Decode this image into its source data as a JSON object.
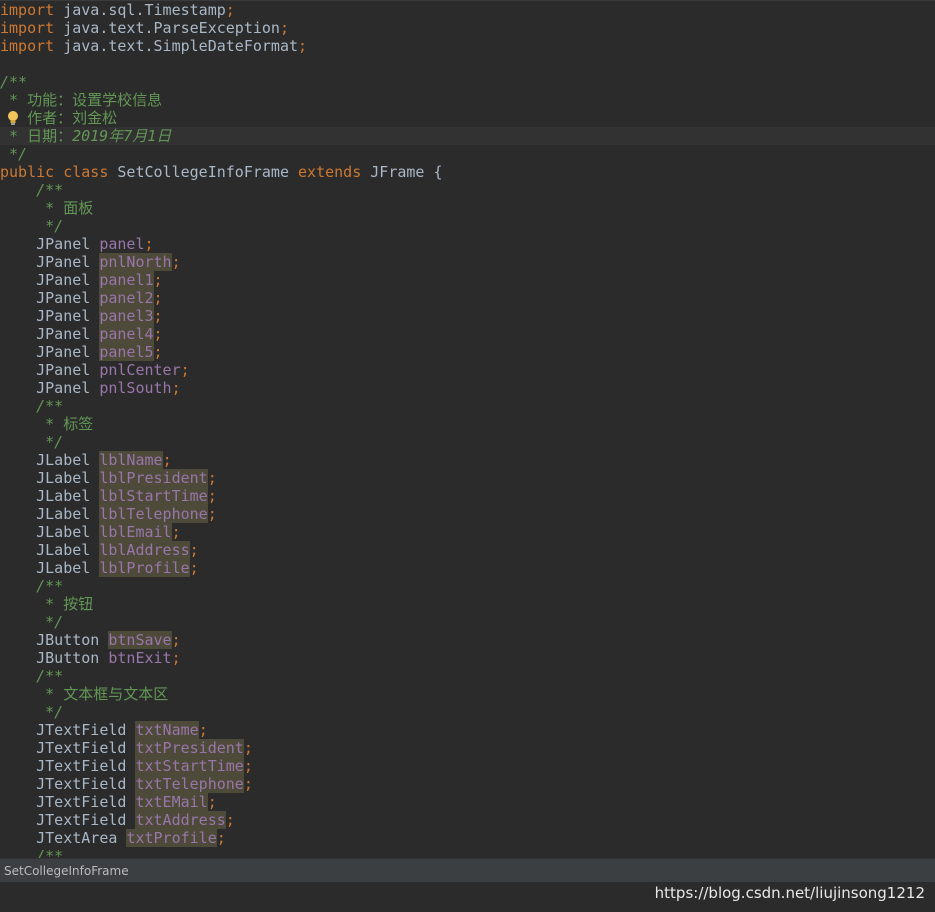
{
  "editor": {
    "lines": [
      {
        "i": 0,
        "segs": [
          {
            "t": "import",
            "c": "kw"
          },
          {
            "t": " java.sql.Timestamp"
          },
          {
            "t": ";",
            "c": "semi"
          }
        ]
      },
      {
        "i": 1,
        "segs": [
          {
            "t": "import",
            "c": "kw"
          },
          {
            "t": " java.text.ParseException"
          },
          {
            "t": ";",
            "c": "semi"
          }
        ]
      },
      {
        "i": 2,
        "segs": [
          {
            "t": "import",
            "c": "kw"
          },
          {
            "t": " java.text.SimpleDateFormat"
          },
          {
            "t": ";",
            "c": "semi"
          }
        ]
      },
      {
        "i": 4,
        "segs": [
          {
            "t": "/**",
            "c": "cm-it"
          }
        ]
      },
      {
        "i": 5,
        "segs": [
          {
            "t": " * 功能：设置学校信息",
            "c": "cm"
          }
        ]
      },
      {
        "i": 6,
        "segs": [
          {
            "t": " * 作者：刘金松",
            "c": "cm"
          }
        ],
        "bulb": true
      },
      {
        "i": 7,
        "segs": [
          {
            "t": " * 日期：",
            "c": "cm"
          },
          {
            "t": "2019年7月1日",
            "c": "cm-it"
          }
        ],
        "current": true
      },
      {
        "i": 8,
        "segs": [
          {
            "t": " */",
            "c": "cm-it"
          }
        ]
      },
      {
        "i": 9,
        "segs": [
          {
            "t": "public class ",
            "c": "kw"
          },
          {
            "t": "SetCollegeInfoFrame "
          },
          {
            "t": "extends ",
            "c": "kw"
          },
          {
            "t": "JFrame {"
          }
        ]
      },
      {
        "i": 10,
        "segs": [
          {
            "t": "    /**",
            "c": "cm-it"
          }
        ]
      },
      {
        "i": 11,
        "segs": [
          {
            "t": "     * 面板",
            "c": "cm"
          }
        ]
      },
      {
        "i": 12,
        "segs": [
          {
            "t": "     */",
            "c": "cm-it"
          }
        ]
      },
      {
        "i": 13,
        "segs": [
          {
            "t": "    JPanel "
          },
          {
            "t": "panel",
            "c": "fld"
          },
          {
            "t": ";",
            "c": "semi"
          }
        ]
      },
      {
        "i": 14,
        "segs": [
          {
            "t": "    JPanel "
          },
          {
            "t": "pnlNorth",
            "c": "fld hl"
          },
          {
            "t": ";",
            "c": "semi"
          }
        ]
      },
      {
        "i": 15,
        "segs": [
          {
            "t": "    JPanel "
          },
          {
            "t": "panel1",
            "c": "fld hl"
          },
          {
            "t": ";",
            "c": "semi"
          }
        ]
      },
      {
        "i": 16,
        "segs": [
          {
            "t": "    JPanel "
          },
          {
            "t": "panel2",
            "c": "fld hl"
          },
          {
            "t": ";",
            "c": "semi"
          }
        ]
      },
      {
        "i": 17,
        "segs": [
          {
            "t": "    JPanel "
          },
          {
            "t": "panel3",
            "c": "fld hl"
          },
          {
            "t": ";",
            "c": "semi"
          }
        ]
      },
      {
        "i": 18,
        "segs": [
          {
            "t": "    JPanel "
          },
          {
            "t": "panel4",
            "c": "fld hl"
          },
          {
            "t": ";",
            "c": "semi"
          }
        ]
      },
      {
        "i": 19,
        "segs": [
          {
            "t": "    JPanel "
          },
          {
            "t": "panel5",
            "c": "fld hl"
          },
          {
            "t": ";",
            "c": "semi"
          }
        ]
      },
      {
        "i": 20,
        "segs": [
          {
            "t": "    JPanel "
          },
          {
            "t": "pnlCenter",
            "c": "fld"
          },
          {
            "t": ";",
            "c": "semi"
          }
        ]
      },
      {
        "i": 21,
        "segs": [
          {
            "t": "    JPanel "
          },
          {
            "t": "pnlSouth",
            "c": "fld"
          },
          {
            "t": ";",
            "c": "semi"
          }
        ]
      },
      {
        "i": 22,
        "segs": [
          {
            "t": "    /**",
            "c": "cm-it"
          }
        ]
      },
      {
        "i": 23,
        "segs": [
          {
            "t": "     * 标签",
            "c": "cm"
          }
        ]
      },
      {
        "i": 24,
        "segs": [
          {
            "t": "     */",
            "c": "cm-it"
          }
        ]
      },
      {
        "i": 25,
        "segs": [
          {
            "t": "    JLabel "
          },
          {
            "t": "lblName",
            "c": "fld hl"
          },
          {
            "t": ";",
            "c": "semi"
          }
        ]
      },
      {
        "i": 26,
        "segs": [
          {
            "t": "    JLabel "
          },
          {
            "t": "lblPresident",
            "c": "fld hl"
          },
          {
            "t": ";",
            "c": "semi"
          }
        ]
      },
      {
        "i": 27,
        "segs": [
          {
            "t": "    JLabel "
          },
          {
            "t": "lblStartTime",
            "c": "fld hl"
          },
          {
            "t": ";",
            "c": "semi"
          }
        ]
      },
      {
        "i": 28,
        "segs": [
          {
            "t": "    JLabel "
          },
          {
            "t": "lblTelephone",
            "c": "fld hl"
          },
          {
            "t": ";",
            "c": "semi"
          }
        ]
      },
      {
        "i": 29,
        "segs": [
          {
            "t": "    JLabel "
          },
          {
            "t": "lblEmail",
            "c": "fld hl"
          },
          {
            "t": ";",
            "c": "semi"
          }
        ]
      },
      {
        "i": 30,
        "segs": [
          {
            "t": "    JLabel "
          },
          {
            "t": "lblAddress",
            "c": "fld hl"
          },
          {
            "t": ";",
            "c": "semi"
          }
        ]
      },
      {
        "i": 31,
        "segs": [
          {
            "t": "    JLabel "
          },
          {
            "t": "lblProfile",
            "c": "fld hl"
          },
          {
            "t": ";",
            "c": "semi"
          }
        ]
      },
      {
        "i": 32,
        "segs": [
          {
            "t": "    /**",
            "c": "cm-it"
          }
        ]
      },
      {
        "i": 33,
        "segs": [
          {
            "t": "     * 按钮",
            "c": "cm"
          }
        ]
      },
      {
        "i": 34,
        "segs": [
          {
            "t": "     */",
            "c": "cm-it"
          }
        ]
      },
      {
        "i": 35,
        "segs": [
          {
            "t": "    JButton "
          },
          {
            "t": "btnSave",
            "c": "fld hl"
          },
          {
            "t": ";",
            "c": "semi"
          }
        ]
      },
      {
        "i": 36,
        "segs": [
          {
            "t": "    JButton "
          },
          {
            "t": "btnExit",
            "c": "fld"
          },
          {
            "t": ";",
            "c": "semi"
          }
        ]
      },
      {
        "i": 37,
        "segs": [
          {
            "t": "    /**",
            "c": "cm-it"
          }
        ]
      },
      {
        "i": 38,
        "segs": [
          {
            "t": "     * 文本框与文本区",
            "c": "cm"
          }
        ]
      },
      {
        "i": 39,
        "segs": [
          {
            "t": "     */",
            "c": "cm-it"
          }
        ]
      },
      {
        "i": 40,
        "segs": [
          {
            "t": "    JTextField "
          },
          {
            "t": "txtName",
            "c": "fld hl"
          },
          {
            "t": ";",
            "c": "semi"
          }
        ]
      },
      {
        "i": 41,
        "segs": [
          {
            "t": "    JTextField "
          },
          {
            "t": "txtPresident",
            "c": "fld hl"
          },
          {
            "t": ";",
            "c": "semi"
          }
        ]
      },
      {
        "i": 42,
        "segs": [
          {
            "t": "    JTextField "
          },
          {
            "t": "txtStartTime",
            "c": "fld hl"
          },
          {
            "t": ";",
            "c": "semi"
          }
        ]
      },
      {
        "i": 43,
        "segs": [
          {
            "t": "    JTextField "
          },
          {
            "t": "txtTelephone",
            "c": "fld hl"
          },
          {
            "t": ";",
            "c": "semi"
          }
        ]
      },
      {
        "i": 44,
        "segs": [
          {
            "t": "    JTextField "
          },
          {
            "t": "txtEMail",
            "c": "fld hl"
          },
          {
            "t": ";",
            "c": "semi"
          }
        ]
      },
      {
        "i": 45,
        "segs": [
          {
            "t": "    JTextField "
          },
          {
            "t": "txtAddress",
            "c": "fld hl"
          },
          {
            "t": ";",
            "c": "semi"
          }
        ]
      },
      {
        "i": 46,
        "segs": [
          {
            "t": "    JTextArea "
          },
          {
            "t": "txtProfile",
            "c": "fld hl"
          },
          {
            "t": ";",
            "c": "semi"
          }
        ]
      },
      {
        "i": 47,
        "segs": [
          {
            "t": "    /**",
            "c": "cm-it"
          }
        ]
      }
    ]
  },
  "statusbar": {
    "breadcrumb": "SetCollegeInfoFrame"
  },
  "watermark": "https://blog.csdn.net/liujinsong1212",
  "icons": {
    "gutter_icon": "lightbulb-icon"
  },
  "colors": {
    "background": "#2b2b2b",
    "keyword": "#cc7832",
    "comment": "#629755",
    "field": "#9876aa",
    "text": "#a9b7c6"
  }
}
